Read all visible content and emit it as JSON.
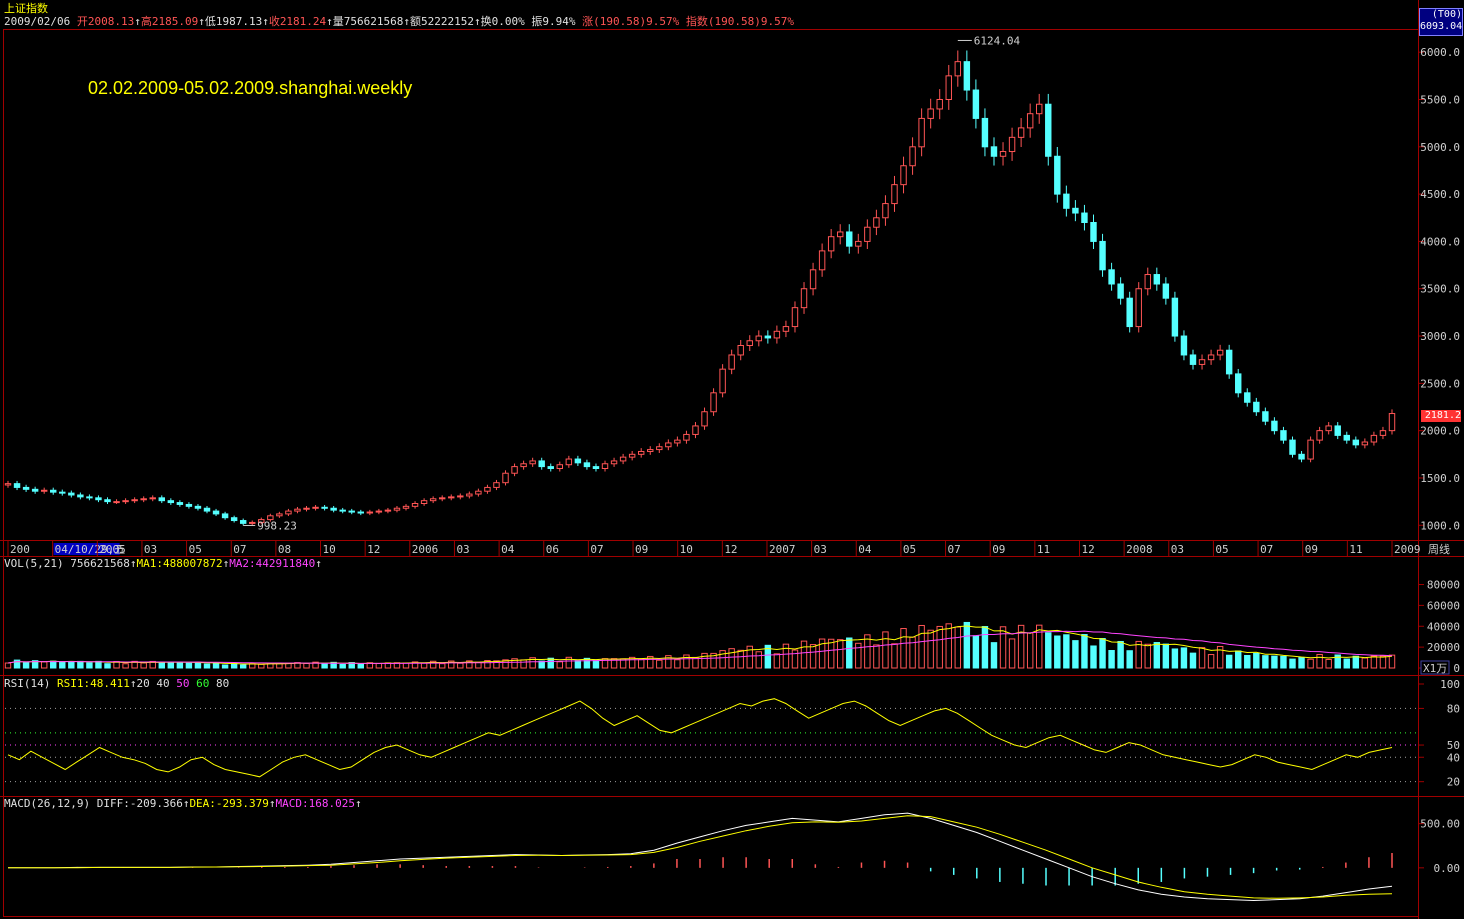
{
  "header": {
    "index_name": "上证指数",
    "date": "2009/02/06",
    "open_label": "开",
    "open": "2008.13",
    "high_label": "高",
    "high": "2185.09",
    "low_label": "低",
    "low": "1987.13",
    "close_label": "收",
    "close": "2181.24",
    "volume_label": "量",
    "volume": "756621568",
    "amount_label": "额",
    "amount": "52222152",
    "turnover_label": "换",
    "turnover": "0.00%",
    "amplitude_label": "振",
    "amplitude": "9.94%",
    "change_label": "涨",
    "change": "(190.58)9.57%",
    "index_change_label": "指数",
    "index_change": "(190.58)9.57%"
  },
  "annotation": "02.02.2009-05.02.2009.shanghai.weekly",
  "price_box": {
    "line1": "(T00)",
    "line2": "6093.04"
  },
  "current_price_tag": "2181.2",
  "max_label": "6124.04",
  "min_label": "998.23",
  "period_label": "周线",
  "vol_unit": "X1万",
  "vol_header": {
    "name": "VOL(5,21)",
    "value": "756621568",
    "ma1": "MA1:488007872",
    "ma2": "MA2:442911840"
  },
  "rsi_header": {
    "name": "RSI(14)",
    "value": "RSI1:48.411",
    "l20": "20",
    "l40": "40",
    "l50": "50",
    "l60": "60",
    "l80": "80"
  },
  "macd_header": {
    "name": "MACD(26,12,9)",
    "diff": "DIFF:-209.366",
    "dea": "DEA:-293.379",
    "macd": "MACD:168.025"
  },
  "colors": {
    "up": "#ff5555",
    "down": "#55ffff",
    "ma1": "#ffff00",
    "ma2": "#ff44ff",
    "axis": "#a00000",
    "grid": "#a00000"
  },
  "chart_data": {
    "type": "candlestick",
    "price_axis": {
      "ticks": [
        "6000.0",
        "5500.0",
        "5000.0",
        "4500.0",
        "4000.0",
        "3500.0",
        "3000.0",
        "2500.0",
        "2000.0",
        "1500.0",
        "1000.0"
      ],
      "values": [
        6000,
        5500,
        5000,
        4500,
        4000,
        3500,
        3000,
        2500,
        2000,
        1500,
        1000
      ],
      "range": [
        950,
        6150
      ]
    },
    "time_labels": [
      "200",
      "04/10/29,五",
      "2005",
      "03",
      "05",
      "07",
      "08",
      "10",
      "12",
      "2006",
      "03",
      "04",
      "06",
      "07",
      "09",
      "10",
      "12",
      "2007",
      "03",
      "04",
      "05",
      "07",
      "09",
      "11",
      "12",
      "2008",
      "03",
      "05",
      "07",
      "09",
      "11",
      "2009"
    ],
    "close_series": [
      1440,
      1400,
      1380,
      1360,
      1370,
      1350,
      1340,
      1320,
      1300,
      1290,
      1270,
      1250,
      1250,
      1260,
      1270,
      1280,
      1290,
      1260,
      1240,
      1220,
      1200,
      1180,
      1150,
      1120,
      1080,
      1050,
      1020,
      1030,
      1060,
      1100,
      1120,
      1150,
      1170,
      1180,
      1190,
      1180,
      1160,
      1150,
      1140,
      1130,
      1140,
      1150,
      1160,
      1180,
      1200,
      1230,
      1260,
      1280,
      1290,
      1300,
      1310,
      1330,
      1360,
      1400,
      1450,
      1550,
      1620,
      1650,
      1680,
      1620,
      1600,
      1640,
      1700,
      1660,
      1620,
      1600,
      1650,
      1680,
      1720,
      1750,
      1780,
      1800,
      1830,
      1870,
      1900,
      1960,
      2050,
      2200,
      2400,
      2650,
      2800,
      2900,
      2950,
      3000,
      2980,
      3050,
      3100,
      3300,
      3500,
      3700,
      3900,
      4050,
      4100,
      3950,
      4000,
      4150,
      4250,
      4400,
      4600,
      4800,
      5000,
      5300,
      5400,
      5500,
      5750,
      5900,
      5600,
      5300,
      5000,
      4900,
      4950,
      5100,
      5200,
      5350,
      5450,
      4900,
      4500,
      4350,
      4300,
      4200,
      4000,
      3700,
      3550,
      3400,
      3100,
      3500,
      3650,
      3550,
      3400,
      3000,
      2800,
      2700,
      2750,
      2800,
      2850,
      2600,
      2400,
      2300,
      2200,
      2100,
      2000,
      1900,
      1750,
      1700,
      1900,
      2000,
      2050,
      1950,
      1900,
      1850,
      1880,
      1950,
      2000,
      2181
    ],
    "volume_axis": {
      "ticks": [
        "80000",
        "60000",
        "40000",
        "20000",
        "0"
      ],
      "values": [
        80000,
        60000,
        40000,
        20000,
        0
      ],
      "range": [
        0,
        92000
      ]
    },
    "rsi_axis": {
      "ticks": [
        "100",
        "80",
        "50",
        "40",
        "20"
      ],
      "values": [
        100,
        80,
        50,
        40,
        20
      ],
      "range": [
        14,
        100
      ]
    },
    "rsi_series": [
      42,
      38,
      45,
      40,
      35,
      30,
      36,
      42,
      48,
      44,
      40,
      38,
      35,
      30,
      28,
      32,
      38,
      40,
      34,
      30,
      28,
      26,
      24,
      30,
      36,
      40,
      42,
      38,
      34,
      30,
      32,
      38,
      44,
      48,
      50,
      46,
      42,
      40,
      44,
      48,
      52,
      56,
      60,
      58,
      62,
      66,
      70,
      74,
      78,
      82,
      86,
      80,
      72,
      66,
      70,
      74,
      68,
      62,
      60,
      64,
      68,
      72,
      76,
      80,
      84,
      82,
      86,
      88,
      84,
      78,
      72,
      76,
      80,
      84,
      86,
      82,
      76,
      70,
      66,
      70,
      74,
      78,
      80,
      76,
      70,
      64,
      58,
      54,
      50,
      48,
      52,
      56,
      58,
      54,
      50,
      46,
      44,
      48,
      52,
      50,
      46,
      42,
      40,
      38,
      36,
      34,
      32,
      34,
      38,
      42,
      40,
      36,
      34,
      32,
      30,
      34,
      38,
      42,
      40,
      44,
      46,
      48
    ],
    "macd_axis": {
      "ticks": [
        "500.00",
        "0.00"
      ],
      "values": [
        500,
        0
      ],
      "range": [
        -500,
        700
      ]
    },
    "diff_series": [
      0,
      0,
      0,
      5,
      5,
      5,
      5,
      5,
      10,
      10,
      15,
      20,
      25,
      30,
      40,
      60,
      80,
      100,
      110,
      120,
      130,
      140,
      150,
      145,
      140,
      145,
      150,
      160,
      200,
      280,
      350,
      420,
      480,
      520,
      560,
      540,
      520,
      560,
      600,
      620,
      560,
      480,
      400,
      300,
      200,
      100,
      0,
      -100,
      -180,
      -250,
      -300,
      -330,
      -350,
      -360,
      -370,
      -360,
      -350,
      -320,
      -280,
      -240,
      -209
    ],
    "dea_series": [
      0,
      0,
      0,
      0,
      5,
      5,
      5,
      5,
      8,
      10,
      12,
      15,
      20,
      25,
      30,
      45,
      60,
      80,
      95,
      110,
      120,
      130,
      140,
      142,
      140,
      142,
      145,
      150,
      175,
      230,
      300,
      360,
      420,
      470,
      510,
      520,
      515,
      530,
      560,
      590,
      580,
      520,
      460,
      380,
      290,
      200,
      100,
      0,
      -80,
      -160,
      -220,
      -270,
      -300,
      -320,
      -340,
      -345,
      -340,
      -330,
      -310,
      -300,
      -293
    ],
    "macd_hist": [
      0,
      0,
      0,
      10,
      5,
      5,
      0,
      0,
      5,
      0,
      5,
      10,
      10,
      10,
      20,
      30,
      40,
      40,
      30,
      20,
      20,
      20,
      20,
      5,
      0,
      5,
      10,
      20,
      50,
      100,
      100,
      120,
      120,
      100,
      100,
      40,
      10,
      60,
      80,
      60,
      -40,
      -80,
      -120,
      -160,
      -180,
      -200,
      -200,
      -200,
      -200,
      -180,
      -160,
      -120,
      -100,
      -80,
      -60,
      -30,
      -20,
      10,
      60,
      120,
      168
    ]
  }
}
